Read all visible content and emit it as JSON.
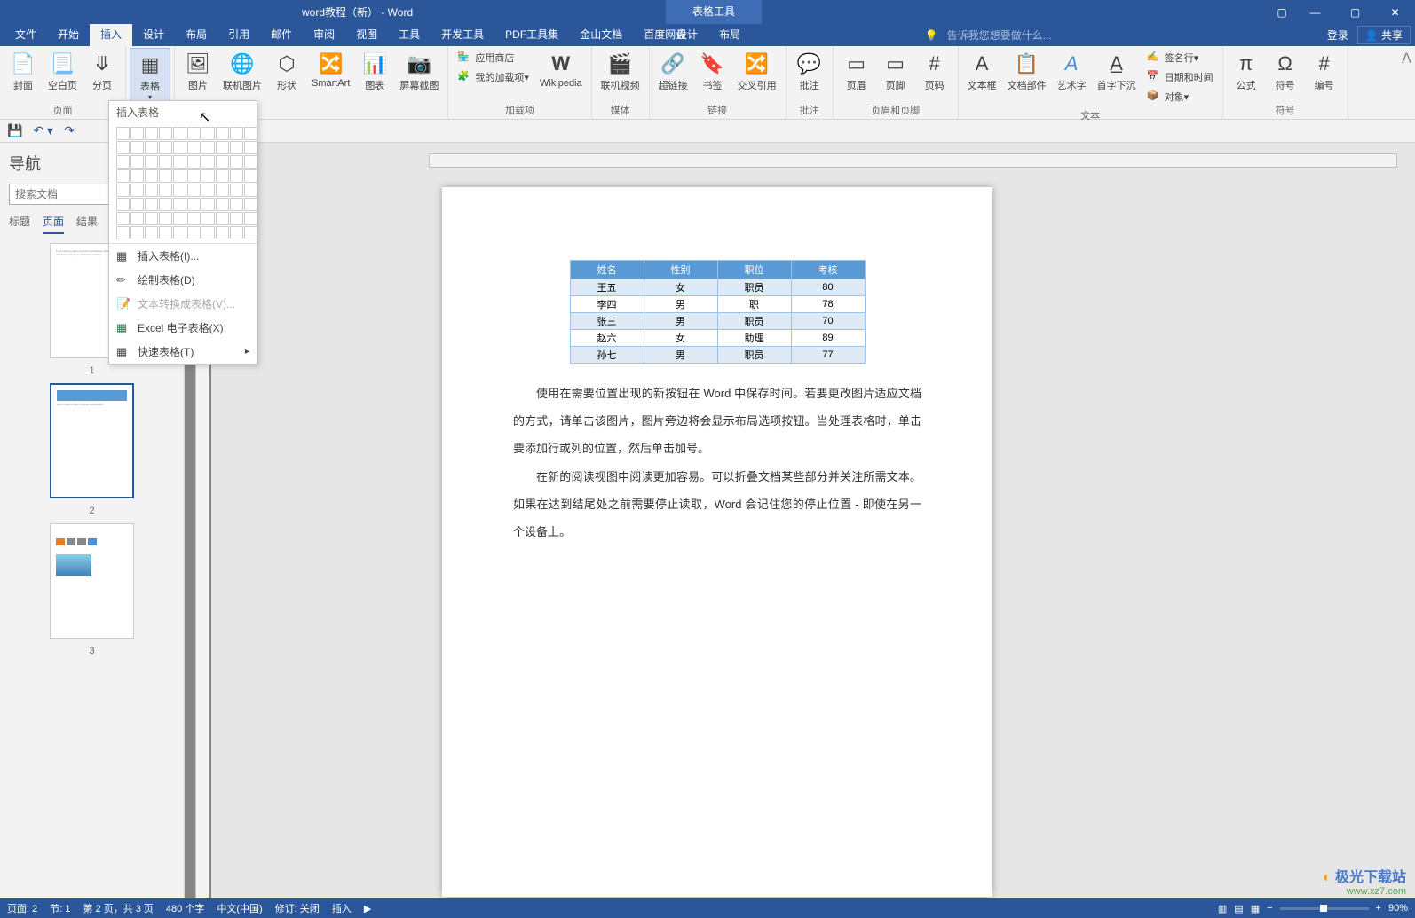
{
  "title": "word教程（新） - Word",
  "table_tools": "表格工具",
  "menu": {
    "file": "文件",
    "home": "开始",
    "insert": "插入",
    "design": "设计",
    "layout": "布局",
    "references": "引用",
    "mailings": "邮件",
    "review": "审阅",
    "view": "视图",
    "tools": "工具",
    "developer": "开发工具",
    "pdf": "PDF工具集",
    "wps": "金山文档",
    "baidu": "百度网盘",
    "tool_design": "设计",
    "tool_layout": "布局",
    "tell_me": "告诉我您想要做什么...",
    "login": "登录",
    "share": "共享"
  },
  "ribbon": {
    "pages": {
      "cover": "封面",
      "blank": "空白页",
      "break": "分页",
      "label": "页面"
    },
    "table": {
      "label": "表格",
      "group": "表格"
    },
    "illustrations": {
      "picture": "图片",
      "online": "联机图片",
      "shapes": "形状",
      "smartart": "SmartArt",
      "chart": "图表",
      "screenshot": "屏幕截图"
    },
    "addins": {
      "store": "应用商店",
      "my": "我的加载项",
      "wiki": "Wikipedia",
      "label": "加载项"
    },
    "media": {
      "video": "联机视频",
      "label": "媒体"
    },
    "links": {
      "hyper": "超链接",
      "bookmark": "书签",
      "cross": "交叉引用",
      "label": "链接"
    },
    "comments": {
      "comment": "批注",
      "label": "批注"
    },
    "headerfooter": {
      "header": "页眉",
      "footer": "页脚",
      "pagenum": "页码",
      "label": "页眉和页脚"
    },
    "text": {
      "textbox": "文本框",
      "parts": "文档部件",
      "wordart": "艺术字",
      "dropcap": "首字下沉",
      "sig": "签名行",
      "date": "日期和时间",
      "object": "对象",
      "label": "文本"
    },
    "symbols": {
      "equation": "公式",
      "symbol": "符号",
      "number": "编号",
      "label": "符号"
    }
  },
  "table_dropdown": {
    "title": "插入表格",
    "insert": "插入表格(I)...",
    "draw": "绘制表格(D)",
    "convert": "文本转换成表格(V)...",
    "excel": "Excel 电子表格(X)",
    "quick": "快速表格(T)"
  },
  "nav": {
    "title": "导航",
    "search_placeholder": "搜索文档",
    "tabs": {
      "headings": "标题",
      "pages": "页面",
      "results": "结果"
    },
    "p1": "1",
    "p2": "2",
    "p3": "3"
  },
  "doc": {
    "table": {
      "headers": [
        "姓名",
        "性别",
        "职位",
        "考核"
      ],
      "rows": [
        [
          "王五",
          "女",
          "职员",
          "80"
        ],
        [
          "李四",
          "男",
          "职",
          "78"
        ],
        [
          "张三",
          "男",
          "职员",
          "70"
        ],
        [
          "赵六",
          "女",
          "助理",
          "89"
        ],
        [
          "孙七",
          "男",
          "职员",
          "77"
        ]
      ]
    },
    "para1": "使用在需要位置出现的新按钮在 Word 中保存时间。若要更改图片适应文档的方式，请单击该图片，图片旁边将会显示布局选项按钮。当处理表格时，单击要添加行或列的位置，然后单击加号。",
    "para2": "在新的阅读视图中阅读更加容易。可以折叠文档某些部分并关注所需文本。如果在达到结尾处之前需要停止读取，Word 会记住您的停止位置 - 即使在另一个设备上。"
  },
  "status": {
    "page": "页面: 2",
    "section": "节: 1",
    "pages": "第 2 页，共 3 页",
    "words": "480 个字",
    "lang": "中文(中国)",
    "track": "修订: 关闭",
    "mode": "插入",
    "zoom": "90%"
  },
  "watermark": {
    "brand": "极光下载站",
    "url": "www.xz7.com"
  }
}
